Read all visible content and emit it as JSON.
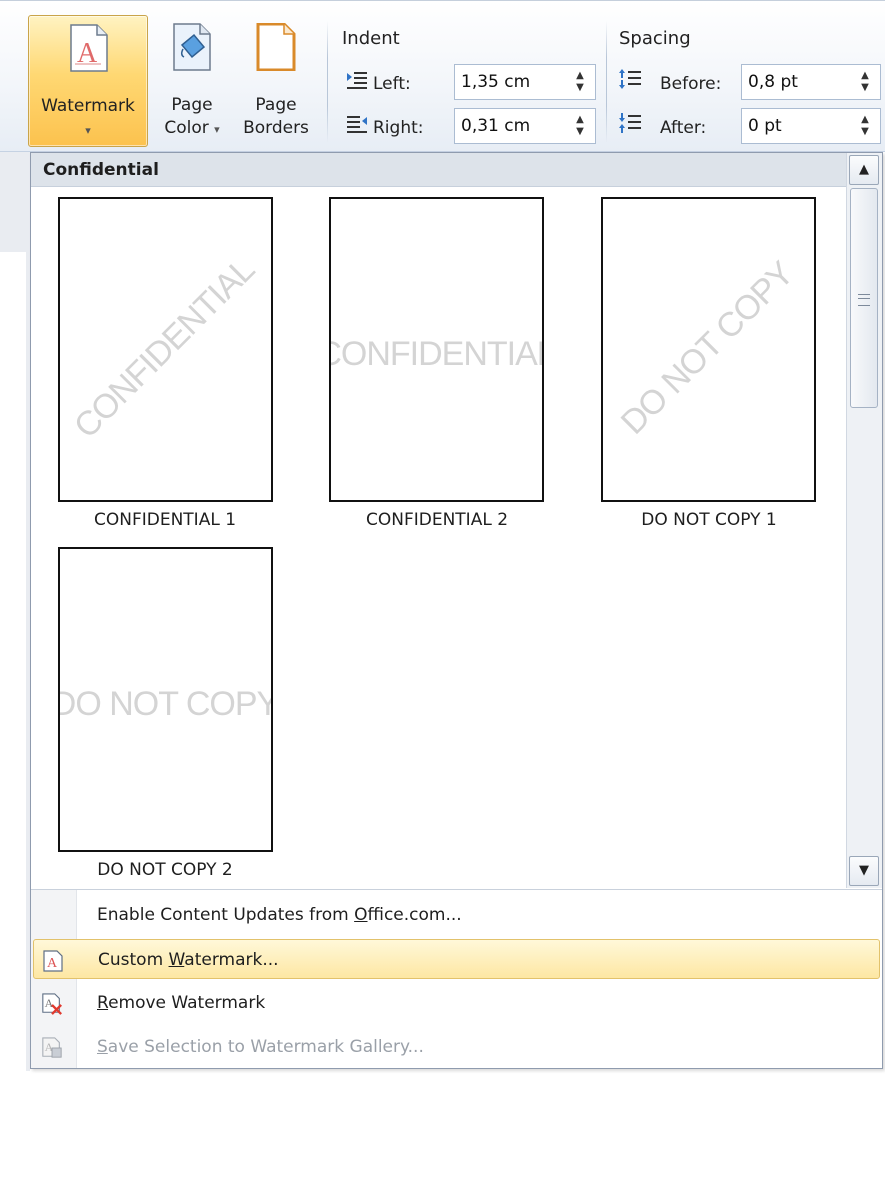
{
  "ribbon": {
    "watermark": {
      "line1": "Watermark",
      "arrow": "▾"
    },
    "page_color": {
      "line1": "Page",
      "line2": "Color",
      "arrow": "▾"
    },
    "page_borders": {
      "line1": "Page",
      "line2": "Borders"
    },
    "indent": {
      "title": "Indent",
      "left_label": "Left:",
      "left_value": "1,35 cm",
      "right_label": "Right:",
      "right_value": "0,31 cm"
    },
    "spacing": {
      "title": "Spacing",
      "before_label": "Before:",
      "before_value": "0,8 pt",
      "after_label": "After:",
      "after_value": "0 pt"
    }
  },
  "gallery": {
    "header": "Confidential",
    "items": [
      {
        "caption": "CONFIDENTIAL 1",
        "watermark": "CONFIDENTIAL",
        "style": "diagonal"
      },
      {
        "caption": "CONFIDENTIAL 2",
        "watermark": "CONFIDENTIAL",
        "style": "horizontal"
      },
      {
        "caption": "DO NOT COPY 1",
        "watermark": "DO NOT COPY",
        "style": "diagonal"
      },
      {
        "caption": "DO NOT COPY 2",
        "watermark": "DO NOT COPY",
        "style": "horizontal"
      }
    ]
  },
  "menu": {
    "enable_updates": {
      "pre": "Enable Content Updates from ",
      "acc": "O",
      "post": "ffice.com..."
    },
    "custom": {
      "pre": "Custom ",
      "acc": "W",
      "post": "atermark..."
    },
    "remove": {
      "pre": "",
      "acc": "R",
      "post": "emove Watermark"
    },
    "save": {
      "pre": "",
      "acc": "S",
      "post": "ave Selection to Watermark Gallery..."
    }
  },
  "colors": {
    "highlight": "#fde7a3",
    "accent_border": "#e2c26b",
    "disabled_text": "#9aa0a8"
  }
}
